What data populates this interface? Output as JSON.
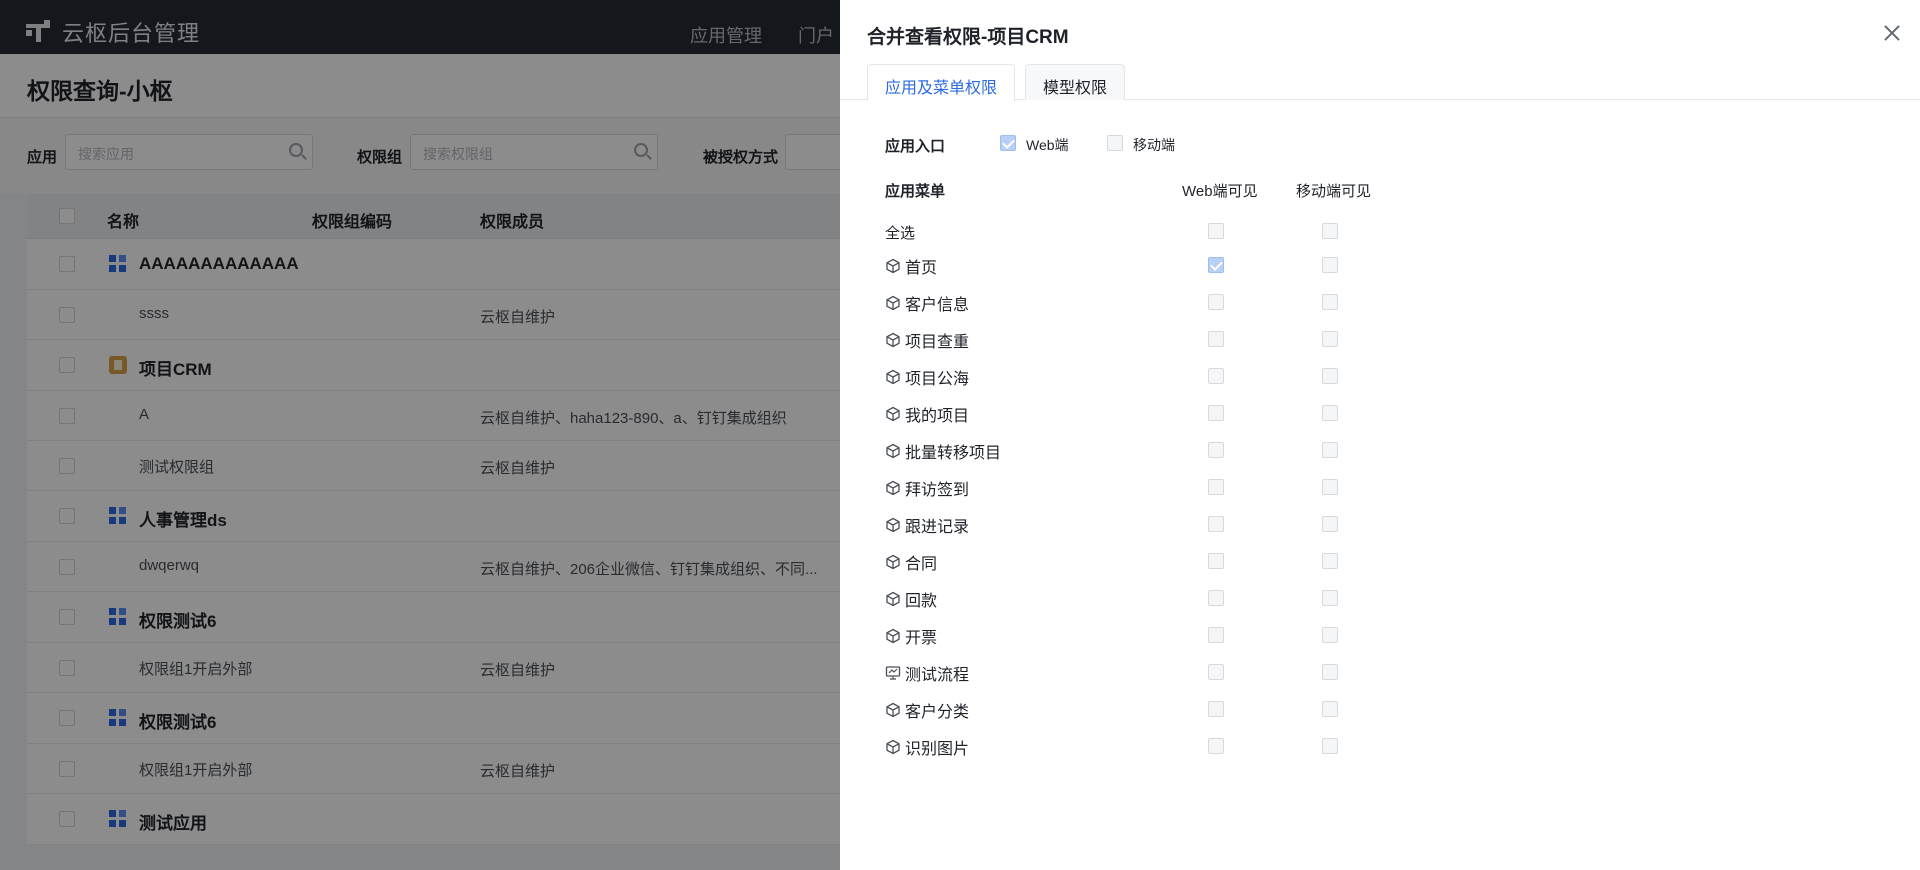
{
  "app": {
    "title": "云枢后台管理",
    "nav": [
      "应用管理",
      "门户"
    ]
  },
  "page": {
    "title": "权限查询-小枢"
  },
  "filters": {
    "app_label": "应用",
    "app_placeholder": "搜索应用",
    "group_label": "权限组",
    "group_placeholder": "搜索权限组",
    "auth_label": "被授权方式"
  },
  "table": {
    "headers": [
      "名称",
      "权限组编码",
      "权限成员"
    ],
    "rows": [
      {
        "type": "app",
        "icon": "grid-app-icon",
        "name": "AAAAAAAAAAAAA",
        "members": ""
      },
      {
        "type": "group",
        "name": "ssss",
        "members": "云枢自维护"
      },
      {
        "type": "app",
        "icon": "document-app-icon",
        "name": "项目CRM",
        "members": ""
      },
      {
        "type": "group",
        "name": "A",
        "members": "云枢自维护、haha123-890、a、钉钉集成组织"
      },
      {
        "type": "group",
        "name": "测试权限组",
        "members": "云枢自维护"
      },
      {
        "type": "app",
        "icon": "grid-app-icon",
        "name": "人事管理ds",
        "members": ""
      },
      {
        "type": "group",
        "name": "dwqerwq",
        "members": "云枢自维护、206企业微信、钉钉集成组织、不同..."
      },
      {
        "type": "app",
        "icon": "grid-app-icon",
        "name": "权限测试6",
        "members": ""
      },
      {
        "type": "group",
        "name": "权限组1开启外部",
        "members": "云枢自维护"
      },
      {
        "type": "app",
        "icon": "grid-app-icon",
        "name": "权限测试6",
        "members": ""
      },
      {
        "type": "group",
        "name": "权限组1开启外部",
        "members": "云枢自维护"
      },
      {
        "type": "app",
        "icon": "grid-app-icon",
        "name": "测试应用",
        "members": ""
      }
    ]
  },
  "drawer": {
    "title": "合并查看权限-项目CRM",
    "tabs": [
      {
        "label": "应用及菜单权限",
        "active": true
      },
      {
        "label": "模型权限",
        "active": false
      }
    ],
    "entry": {
      "label": "应用入口",
      "options": [
        {
          "label": "Web端",
          "checked": true
        },
        {
          "label": "移动端",
          "checked": false
        }
      ]
    },
    "menu": {
      "label": "应用菜单",
      "col_web": "Web端可见",
      "col_mobile": "移动端可见",
      "select_all": "全选",
      "items": [
        {
          "name": "首页",
          "icon": "cube-icon",
          "web": true,
          "mobile": false
        },
        {
          "name": "客户信息",
          "icon": "cube-icon",
          "web": false,
          "mobile": false
        },
        {
          "name": "项目查重",
          "icon": "cube-icon",
          "web": false,
          "mobile": false
        },
        {
          "name": "项目公海",
          "icon": "cube-icon",
          "web": false,
          "mobile": false
        },
        {
          "name": "我的项目",
          "icon": "cube-icon",
          "web": false,
          "mobile": false
        },
        {
          "name": "批量转移项目",
          "icon": "cube-icon",
          "web": false,
          "mobile": false
        },
        {
          "name": "拜访签到",
          "icon": "cube-icon",
          "web": false,
          "mobile": false
        },
        {
          "name": "跟进记录",
          "icon": "cube-icon",
          "web": false,
          "mobile": false
        },
        {
          "name": "合同",
          "icon": "cube-icon",
          "web": false,
          "mobile": false
        },
        {
          "name": "回款",
          "icon": "cube-icon",
          "web": false,
          "mobile": false
        },
        {
          "name": "开票",
          "icon": "cube-icon",
          "web": false,
          "mobile": false
        },
        {
          "name": "测试流程",
          "icon": "workflow-icon",
          "web": false,
          "mobile": false
        },
        {
          "name": "客户分类",
          "icon": "cube-icon",
          "web": false,
          "mobile": false
        },
        {
          "name": "识别图片",
          "icon": "cube-icon",
          "web": false,
          "mobile": false
        }
      ]
    }
  }
}
